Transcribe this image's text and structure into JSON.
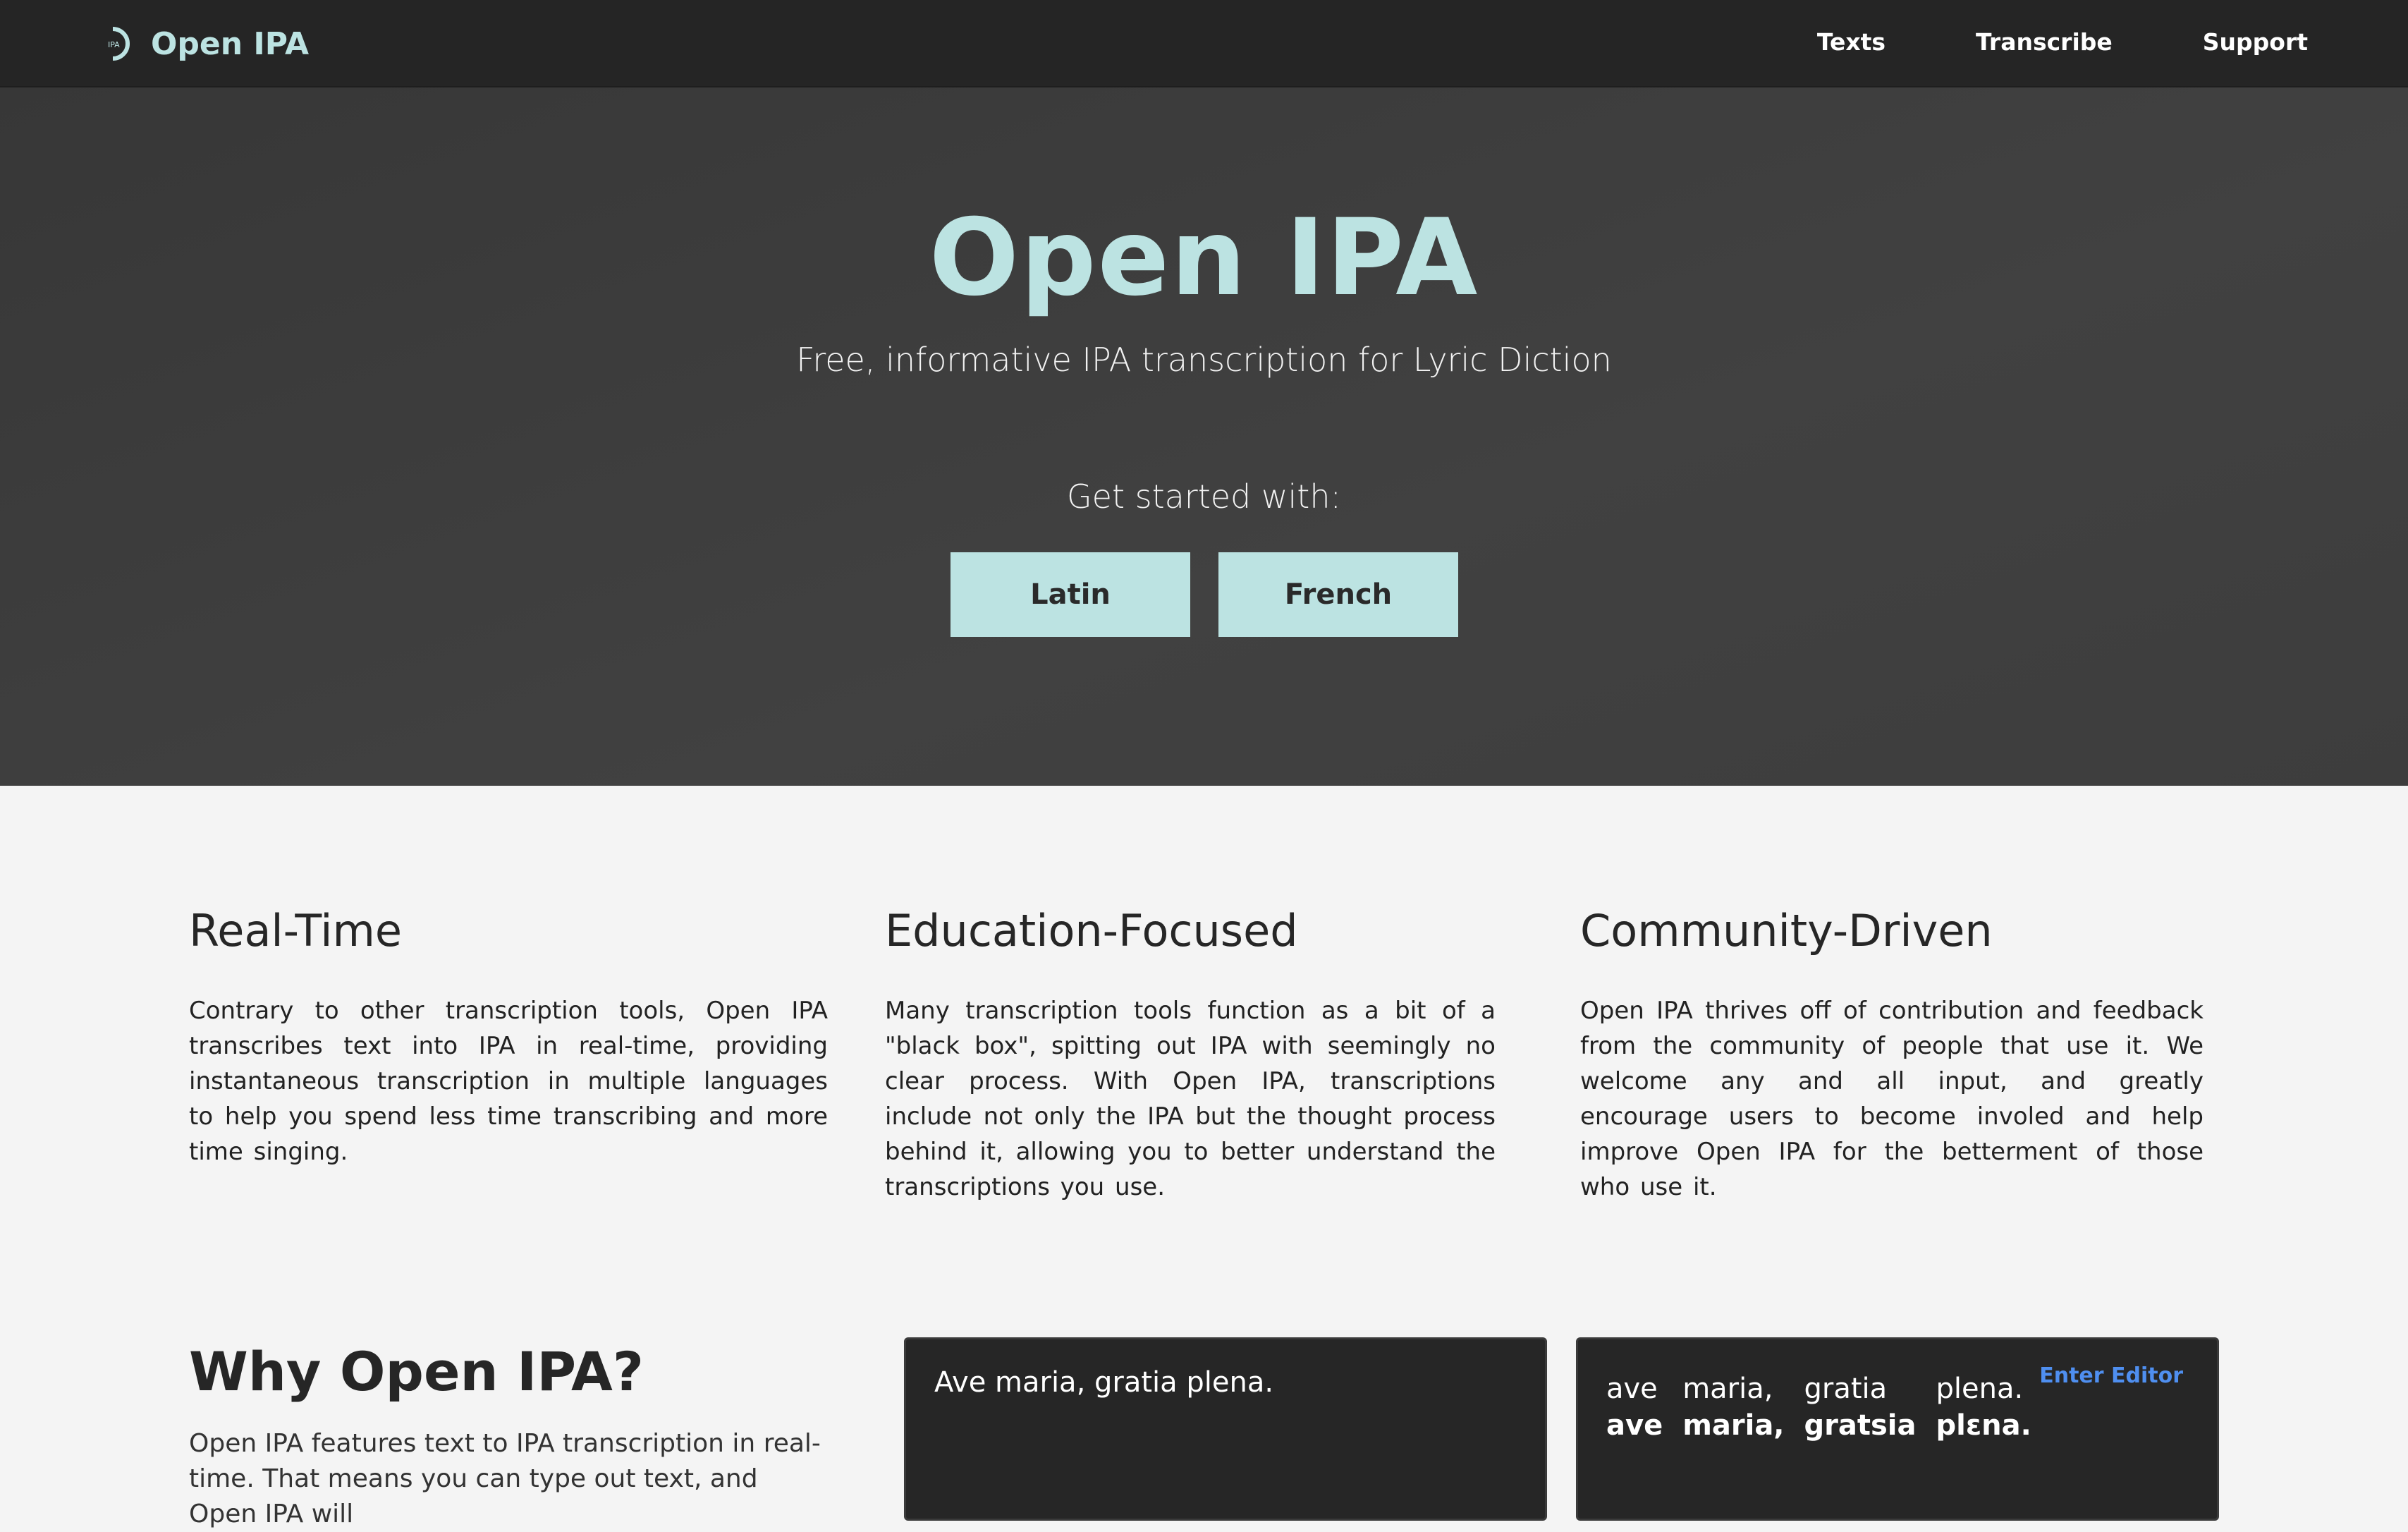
{
  "nav": {
    "brand": "Open IPA",
    "logo_text": "IPA",
    "links": [
      "Texts",
      "Transcribe",
      "Support"
    ]
  },
  "hero": {
    "title": "Open IPA",
    "subtitle": "Free, informative IPA transcription for Lyric Diction",
    "cta_label": "Get started with:",
    "buttons": [
      "Latin",
      "French"
    ]
  },
  "features": [
    {
      "title": "Real-Time",
      "body": "Contrary to other transcription tools, Open IPA transcribes text into IPA in real-time, providing instantaneous transcription in multiple languages to help you spend less time transcribing and more time singing."
    },
    {
      "title": "Education-Focused",
      "body": "Many transcription tools function as a bit of a \"black box\", spitting out IPA with seemingly no clear process. With Open IPA, transcriptions include not only the IPA but the thought process behind it, allowing you to better understand the transcriptions you use."
    },
    {
      "title": "Community-Driven",
      "body": "Open IPA thrives off of contribution and feedback from the community of people that use it. We welcome any and all input, and greatly encourage users to become involed and help improve Open IPA for the betterment of those who use it."
    }
  ],
  "why": {
    "title": "Why Open IPA?",
    "body": "Open IPA features text to IPA transcription in real-time. That means you can type out text, and Open IPA will"
  },
  "demo": {
    "input_text": "Ave maria, gratia plena.",
    "enter_editor": "Enter Editor",
    "words": [
      {
        "text": "ave",
        "ipa": "ave"
      },
      {
        "text": "maria,",
        "ipa": "maria,"
      },
      {
        "text": "gratia",
        "ipa": "gratsia"
      },
      {
        "text": "plena.",
        "ipa": "plɛna."
      }
    ]
  },
  "colors": {
    "accent": "#bce3e2",
    "nav_bg": "#252525",
    "hero_bg": "#3d3d3d",
    "page_bg": "#f4f4f4",
    "link_blue": "#4f8ff0"
  }
}
